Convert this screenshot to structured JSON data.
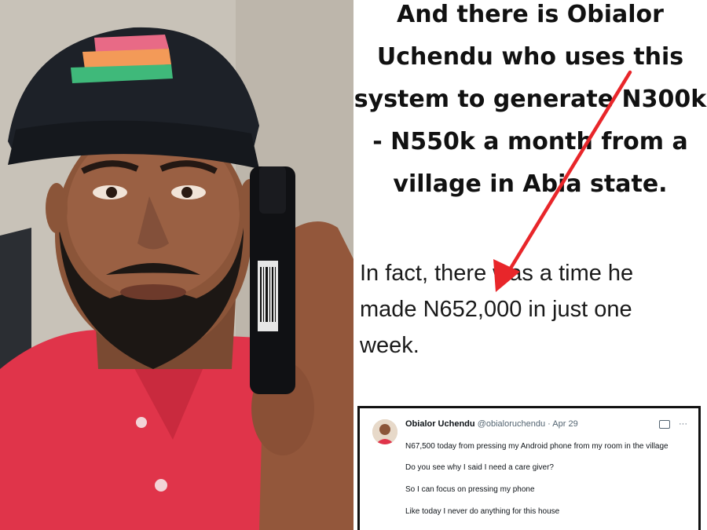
{
  "headline": {
    "line1": "And there is Obialor",
    "line2": "Uchendu who uses this",
    "line3": "system to generate N300k",
    "line4": "- N550k a month from a",
    "line5": "village in Abia state."
  },
  "body": {
    "line1": "In fact, there was a time he",
    "line2": "made N652,000 in just one",
    "line3": "week."
  },
  "tweet": {
    "name": "Obialor Uchendu",
    "handle": "@obialoruchendu",
    "separator": "·",
    "date": "Apr 29",
    "more": "···",
    "lines": [
      "N67,500 today from pressing my Android phone from my room in the village",
      "Do you see why I said I need a care giver?",
      "So I can focus on pressing my phone",
      "Like today I never do anything for this house"
    ]
  },
  "colors": {
    "arrow": "#e8262a",
    "cap": "#1d2128",
    "shirt": "#e0344a",
    "wall": "#c9c3b9"
  }
}
